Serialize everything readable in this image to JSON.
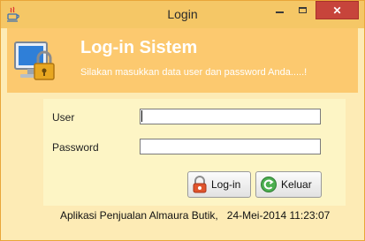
{
  "window": {
    "title": "Login",
    "controls": {
      "minimize": "minimize",
      "maximize": "maximize",
      "close": "✕"
    }
  },
  "header": {
    "title": "Log-in Sistem",
    "subtitle": "Silakan masukkan data user dan password Anda.....!"
  },
  "form": {
    "user_label": "User",
    "user_value": "",
    "password_label": "Password",
    "password_value": ""
  },
  "buttons": {
    "login_label": "Log-in",
    "exit_label": "Keluar"
  },
  "status": {
    "text": "Aplikasi Penjualan Almaura Butik,   24-Mei-2014 11:23:07"
  },
  "colors": {
    "window_bg": "#fdebb5",
    "header_bg": "#fcc96f",
    "panel_bg": "#fdf5c5",
    "close_button": "#c7443b"
  },
  "icons": {
    "app": "java-cup-icon",
    "header": "computer-lock-icon",
    "login": "lock-icon",
    "exit": "exit-arrow-icon"
  }
}
